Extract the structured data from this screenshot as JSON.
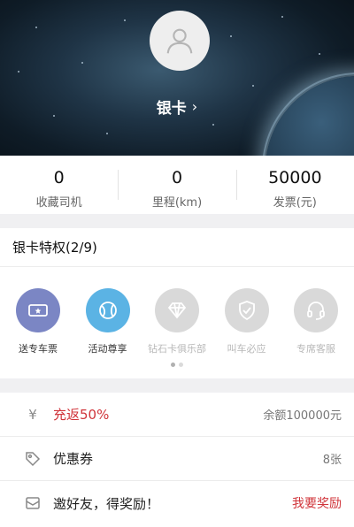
{
  "header": {
    "level_label": "银卡",
    "chevron": "›",
    "avatar_icon": "user-avatar-icon"
  },
  "stats": [
    {
      "value": "0",
      "label": "收藏司机"
    },
    {
      "value": "0",
      "label": "里程(km)"
    },
    {
      "value": "50000",
      "label": "发票(元)"
    }
  ],
  "privileges": {
    "title": "银卡特权(2/9)",
    "items": [
      {
        "label": "送专车票",
        "icon": "ticket-icon",
        "active": true,
        "color": "#7b86c4"
      },
      {
        "label": "活动尊享",
        "icon": "ball-icon",
        "active": true,
        "color": "#5bb3e4"
      },
      {
        "label": "钻石卡俱乐部",
        "icon": "diamond-icon",
        "active": false,
        "color": "#d9d9d9"
      },
      {
        "label": "叫车必应",
        "icon": "shield-icon",
        "active": false,
        "color": "#d9d9d9"
      },
      {
        "label": "专席客服",
        "icon": "headset-icon",
        "active": false,
        "color": "#d9d9d9"
      }
    ],
    "page_dots": 2,
    "active_dot": 0
  },
  "rows": [
    {
      "icon": "yen-icon",
      "title": "充返50%",
      "right": "余额100000元",
      "title_color": "#d0343a"
    },
    {
      "icon": "tag-icon",
      "title": "优惠券",
      "right": "8张"
    },
    {
      "icon": "envelope-icon",
      "title": "邀好友，得奖励！",
      "right": "我要奖励",
      "right_color": "#d0343a"
    }
  ]
}
